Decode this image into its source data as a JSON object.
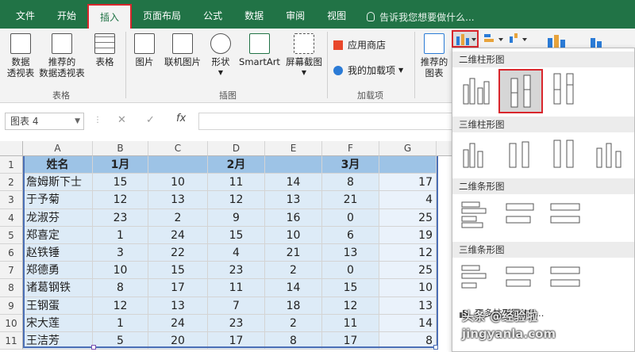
{
  "tabs": [
    "文件",
    "开始",
    "插入",
    "页面布局",
    "公式",
    "数据",
    "审阅",
    "视图"
  ],
  "tell_me": "告诉我您想要做什么...",
  "ribbon": {
    "pivot": "数据\n透视表",
    "rec_pivot": "推荐的\n数据透视表",
    "table": "表格",
    "group_tables": "表格",
    "picture": "图片",
    "online_pic": "联机图片",
    "shapes": "形状",
    "smartart": "SmartArt",
    "screenshot": "屏幕截图",
    "group_illus": "插图",
    "store": "应用商店",
    "myaddins": "我的加载项",
    "group_addins": "加载项",
    "rec_charts": "推荐的\n图表"
  },
  "formula": {
    "namebox": "图表 4",
    "fx": "fx"
  },
  "columns": [
    "A",
    "B",
    "C",
    "D",
    "E",
    "F",
    "G"
  ],
  "rows": [
    "1",
    "2",
    "3",
    "4",
    "5",
    "6",
    "7",
    "8",
    "9",
    "10",
    "11"
  ],
  "header_row": [
    "姓名",
    "1月",
    "",
    "2月",
    "",
    "3月",
    ""
  ],
  "data_rows": [
    [
      "詹姆斯下士",
      "15",
      "10",
      "11",
      "14",
      "8",
      "17"
    ],
    [
      "于予菊",
      "12",
      "13",
      "12",
      "13",
      "21",
      "4"
    ],
    [
      "龙淑芬",
      "23",
      "2",
      "9",
      "16",
      "0",
      "25"
    ],
    [
      "郑喜定",
      "1",
      "24",
      "15",
      "10",
      "6",
      "19"
    ],
    [
      "赵铁锤",
      "3",
      "22",
      "4",
      "21",
      "13",
      "12"
    ],
    [
      "郑德勇",
      "10",
      "15",
      "23",
      "2",
      "0",
      "25"
    ],
    [
      "诸葛钢铁",
      "8",
      "17",
      "11",
      "14",
      "15",
      "10"
    ],
    [
      "王钢蛋",
      "12",
      "13",
      "7",
      "18",
      "12",
      "13"
    ],
    [
      "宋大莲",
      "1",
      "24",
      "23",
      "2",
      "11",
      "14"
    ],
    [
      "王洁芳",
      "5",
      "20",
      "17",
      "8",
      "17",
      "8"
    ]
  ],
  "gallery": {
    "sec1": "二维柱形图",
    "sec2": "三维柱形图",
    "sec3": "二维条形图",
    "sec4": "三维条形图",
    "more": "更多柱形图(M)..."
  },
  "watermark": "头条 @经验啦 jingyanla.com",
  "colors": {
    "brand": "#217346",
    "highlight": "#d9262c",
    "header_fill": "#9dc3e6",
    "data_fill": "#ddebf7"
  }
}
